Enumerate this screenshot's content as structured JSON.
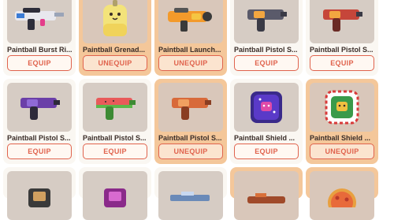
{
  "items": [
    {
      "name": "Paintball Burst Ri...",
      "button": "EQUIP",
      "equipped": false,
      "icon": "burst-rifle-icon"
    },
    {
      "name": "Paintball Grenad...",
      "button": "UNEQUIP",
      "equipped": true,
      "icon": "grenade-chick-icon"
    },
    {
      "name": "Paintball Launch...",
      "button": "UNEQUIP",
      "equipped": true,
      "icon": "launcher-icon"
    },
    {
      "name": "Paintball Pistol S...",
      "button": "EQUIP",
      "equipped": false,
      "icon": "pistol-icon"
    },
    {
      "name": "Paintball Pistol S...",
      "button": "EQUIP",
      "equipped": false,
      "icon": "pistol-icon"
    },
    {
      "name": "Paintball Pistol S...",
      "button": "EQUIP",
      "equipped": false,
      "icon": "pistol-purple-icon"
    },
    {
      "name": "Paintball Pistol S...",
      "button": "EQUIP",
      "equipped": false,
      "icon": "pistol-watermelon-icon"
    },
    {
      "name": "Paintball Pistol S...",
      "button": "UNEQUIP",
      "equipped": true,
      "icon": "pistol-orange-icon"
    },
    {
      "name": "Paintball Shield ...",
      "button": "EQUIP",
      "equipped": false,
      "icon": "shield-galaxy-icon"
    },
    {
      "name": "Paintball Shield ...",
      "button": "UNEQUIP",
      "equipped": true,
      "icon": "shield-candycane-icon"
    }
  ],
  "colors": {
    "card_white": "#faf7f2",
    "card_equipped": "#f4c79a",
    "button_text": "#e0634d"
  }
}
